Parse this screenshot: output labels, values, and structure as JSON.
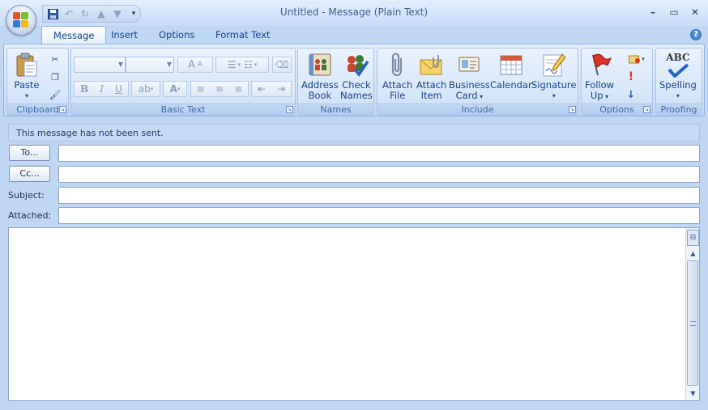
{
  "window": {
    "title": "Untitled - Message (Plain Text)",
    "controls": {
      "minimize": "–",
      "maximize": "▭",
      "close": "✕"
    }
  },
  "quick_access": [
    "save-icon",
    "undo-icon",
    "redo-icon",
    "up-arrow-icon",
    "down-arrow-icon",
    "customize-icon"
  ],
  "tabs": [
    {
      "label": "Message",
      "active": true
    },
    {
      "label": "Insert",
      "active": false
    },
    {
      "label": "Options",
      "active": false
    },
    {
      "label": "Format Text",
      "active": false
    }
  ],
  "help_label": "?",
  "ribbon": {
    "clipboard": {
      "label": "Clipboard",
      "paste": "Paste"
    },
    "basic_text": {
      "label": "Basic Text",
      "bold": "B",
      "italic": "I",
      "underline": "U",
      "grow": "A",
      "shrink": "A",
      "color": "A"
    },
    "names": {
      "label": "Names",
      "address_book_1": "Address",
      "address_book_2": "Book",
      "check_names_1": "Check",
      "check_names_2": "Names"
    },
    "include": {
      "label": "Include",
      "attach_file_1": "Attach",
      "attach_file_2": "File",
      "attach_item_1": "Attach",
      "attach_item_2": "Item",
      "business_card_1": "Business",
      "business_card_2": "Card",
      "calendar": "Calendar",
      "signature": "Signature"
    },
    "options": {
      "label": "Options",
      "follow_up_1": "Follow",
      "follow_up_2": "Up"
    },
    "proofing": {
      "label": "Proofing",
      "spelling": "Spelling",
      "abc": "ABC"
    }
  },
  "infobar": {
    "text": "This message has not been sent."
  },
  "fields": {
    "to_button": "To...",
    "cc_button": "Cc...",
    "subject_label": "Subject:",
    "attached_label": "Attached:",
    "to_value": "",
    "cc_value": "",
    "subject_value": "",
    "attached_value": ""
  },
  "body": {
    "text": ""
  }
}
